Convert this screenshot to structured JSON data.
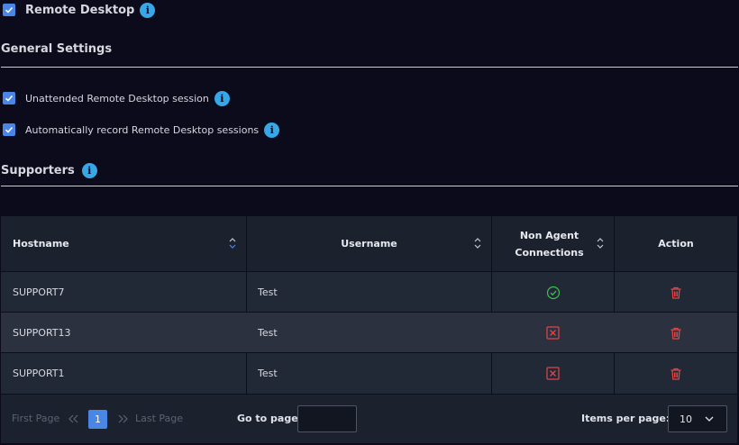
{
  "remote_desktop": {
    "label": "Remote Desktop",
    "checked": true
  },
  "general_settings": {
    "title": "General Settings",
    "options": [
      {
        "label": "Unattended Remote Desktop session",
        "checked": true
      },
      {
        "label": "Automatically record Remote Desktop sessions",
        "checked": true
      }
    ]
  },
  "supporters": {
    "title": "Supporters",
    "columns": [
      "Hostname",
      "Username",
      "Non Agent",
      "Connections",
      "Action"
    ],
    "rows": [
      {
        "hostname": "SUPPORT7",
        "username": "Test",
        "non_agent": "allowed",
        "action": "delete"
      },
      {
        "hostname": "SUPPORT13",
        "username": "Test",
        "non_agent": "denied",
        "action": "delete"
      },
      {
        "hostname": "SUPPORT1",
        "username": "Test",
        "non_agent": "denied",
        "action": "delete"
      }
    ]
  },
  "pagination": {
    "first": "First Page",
    "last": "Last Page",
    "current": "1",
    "goto_label": "Go to page:",
    "goto_value": "",
    "per_page_label": "Items per page:",
    "per_page_value": "10"
  },
  "colors": {
    "accent": "#4a86e6",
    "info": "#38a7e8",
    "success": "#3fbf4f",
    "danger": "#e04646"
  }
}
